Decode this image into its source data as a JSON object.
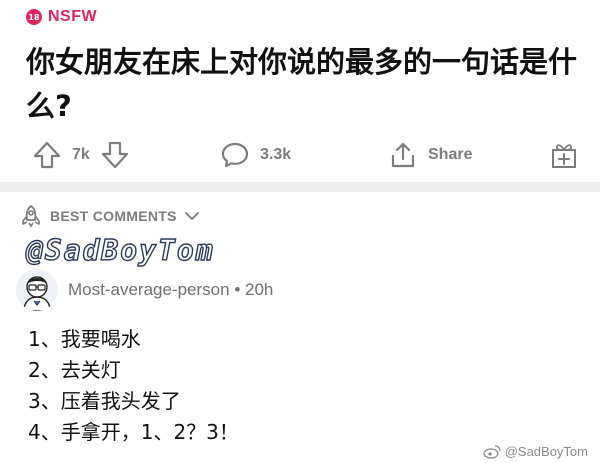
{
  "post": {
    "nsfw_badge": "18",
    "nsfw_label": "NSFW",
    "title": "你女朋友在床上对你说的最多的一句话是什么?"
  },
  "actions": {
    "upvotes": "7k",
    "comments": "3.3k",
    "share_label": "Share"
  },
  "comments_section": {
    "sort_label": "BEST COMMENTS"
  },
  "overlay_watermark_top": "@SadBoyTom",
  "comment": {
    "author": "Most-average-person",
    "separator": "•",
    "age": "20h",
    "lines": [
      "1、我要喝水",
      "2、去关灯",
      "3、压着我头发了",
      "4、手拿开，1、2？3！"
    ]
  },
  "overlay_watermark_bottom": "@SadBoyTom",
  "colors": {
    "nsfw": "#e0245e",
    "muted": "#7c7c7c",
    "divider": "#ededed"
  }
}
